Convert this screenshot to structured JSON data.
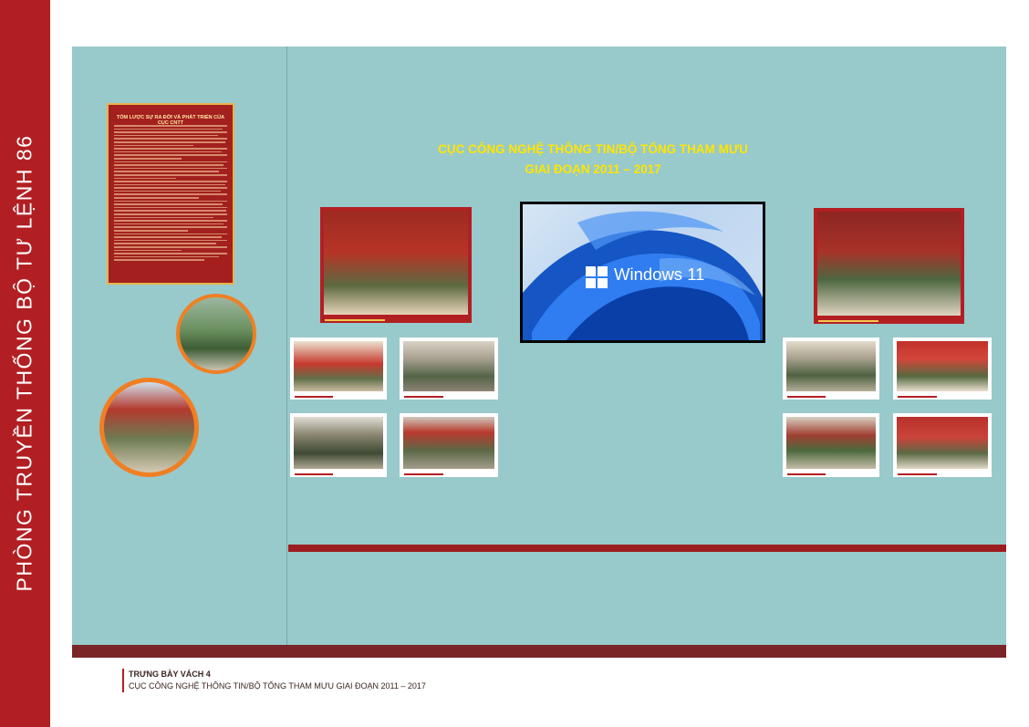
{
  "sidebar": {
    "title": "PHÒNG TRUYỀN THỐNG BỘ TƯ LỆNH 86"
  },
  "wall": {
    "heading_line1": "CỤC CÔNG NGHỆ THÔNG TIN/BỘ TỔNG THAM MƯU",
    "heading_line2": "GIAI ĐOẠN 2011 – 2017",
    "intro_panel_title": "TÓM LƯỢC SỰ RA ĐỜI VÀ PHÁT TRIỂN CỦA CỤC CNTT"
  },
  "screen": {
    "brand": "Windows 11"
  },
  "colors": {
    "accent_red": "#b21f23",
    "wall": "#98c9cb",
    "heading": "#ffe600",
    "circle_frame": "#f07f23"
  },
  "caption": {
    "line1": "TRƯNG BÀY VÁCH 4",
    "line2": "CỤC CÔNG NGHỆ THÔNG TIN/BỘ TỔNG THAM MƯU GIAI ĐOẠN 2011 – 2017"
  }
}
